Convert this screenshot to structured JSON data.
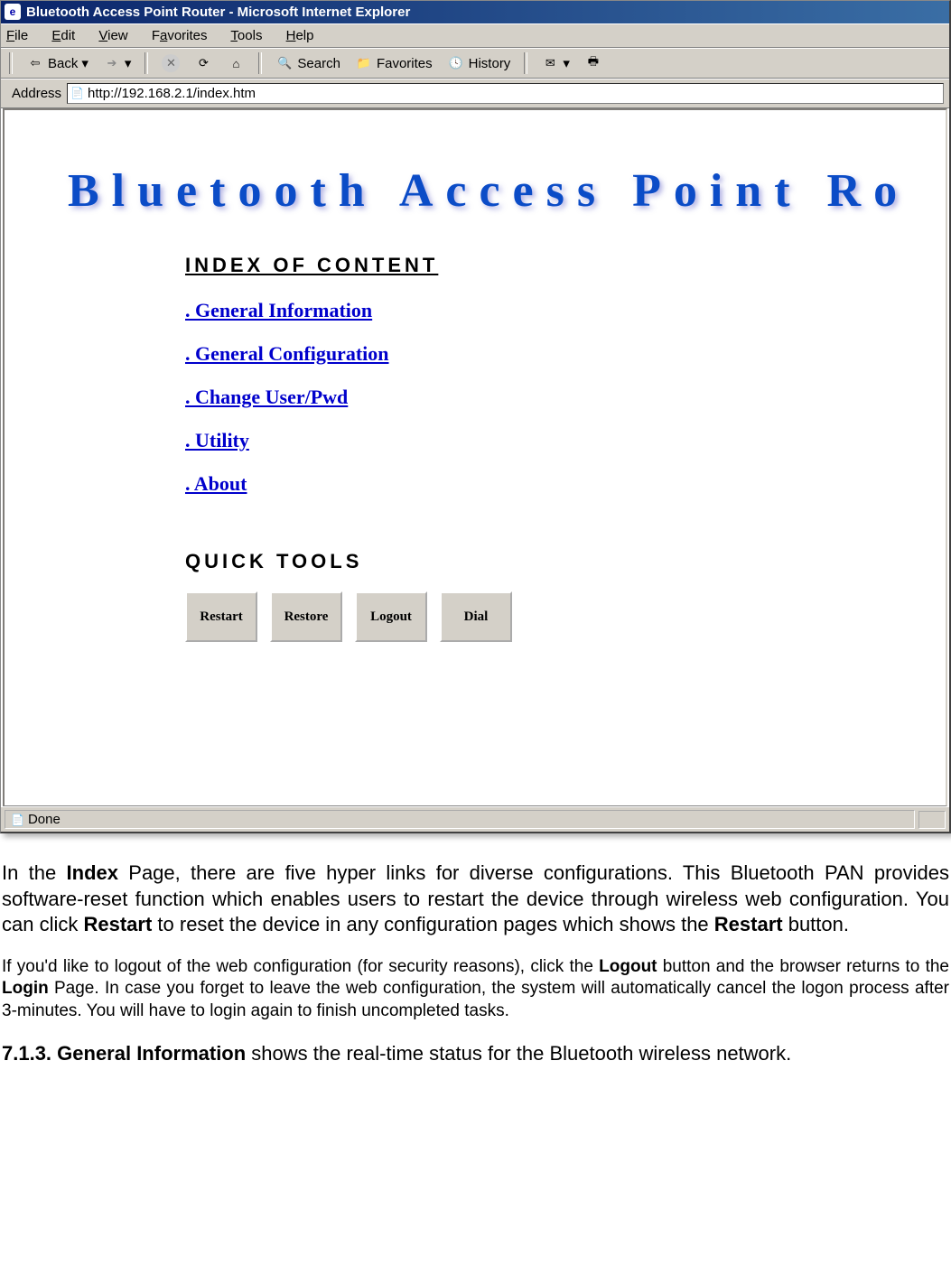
{
  "window": {
    "title": "Bluetooth Access Point Router - Microsoft Internet Explorer"
  },
  "menubar": {
    "file": "File",
    "edit": "Edit",
    "view": "View",
    "favorites": "Favorites",
    "tools": "Tools",
    "help": "Help"
  },
  "toolbar": {
    "back": "Back",
    "search": "Search",
    "favorites": "Favorites",
    "history": "History"
  },
  "addressbar": {
    "label": "Address",
    "url": "http://192.168.2.1/index.htm"
  },
  "page": {
    "banner": "Bluetooth  Access  Point  Ro",
    "index_heading": "INDEX  OF  CONTENT",
    "links": {
      "general_info": ". General Information",
      "general_config": ". General Configuration",
      "change_user": ". Change User/Pwd",
      "utility": ". Utility",
      "about": ". About"
    },
    "quick_tools_heading": "QUICK  TOOLS",
    "buttons": {
      "restart": "Restart",
      "restore": "Restore",
      "logout": "Logout",
      "dial": "Dial"
    }
  },
  "statusbar": {
    "text": "Done"
  },
  "doc": {
    "p1_a": "In the ",
    "p1_b": "Index",
    "p1_c": " Page, there are five hyper links for diverse configurations. This Bluetooth PAN provides software-reset function which enables users to restart the device through wireless web configuration. You can click ",
    "p1_d": "Restart",
    "p1_e": " to reset the device in any configuration pages which shows the ",
    "p1_f": "Restart",
    "p1_g": " button.",
    "p2_a": "If you'd like to logout of the web configuration (for security reasons), click the ",
    "p2_b": "Logout",
    "p2_c": " button and the browser returns to the ",
    "p2_d": "Login",
    "p2_e": " Page.  In case you forget to leave the web configuration, the system will automatically cancel the logon process after 3-minutes.  You will have to login again to finish uncompleted tasks.",
    "p3_a": "7.1.3.  General  Information",
    "p3_b": "  shows  the  real-time  status  for  the  Bluetooth wireless network."
  }
}
